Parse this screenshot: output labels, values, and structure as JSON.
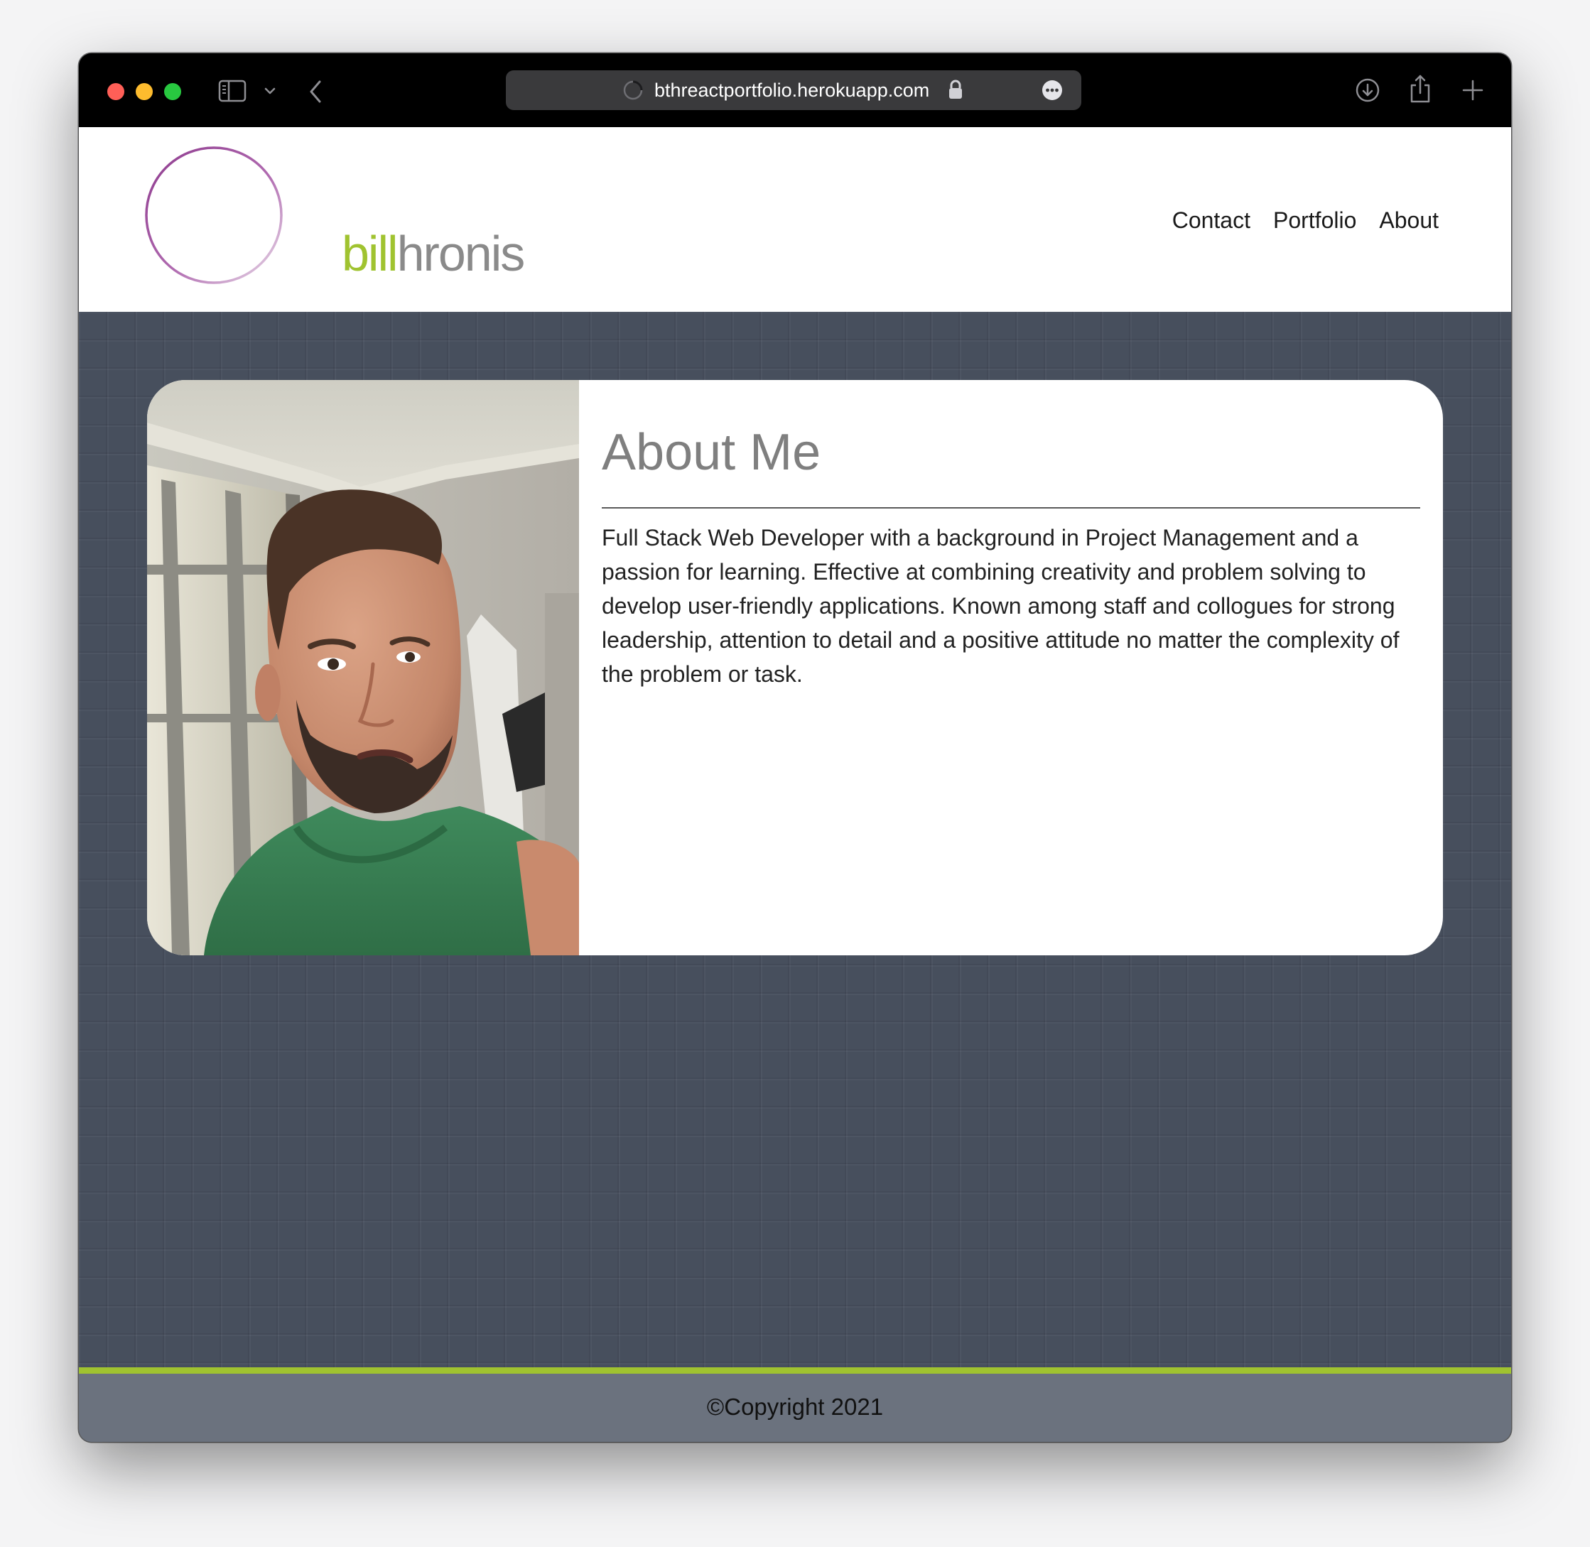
{
  "browser": {
    "url": "bthreactportfolio.herokuapp.com",
    "icons": [
      "sidebar-icon",
      "chevron-down-icon",
      "back-arrow-icon",
      "loading-spinner-icon",
      "lock-icon",
      "more-icon",
      "download-icon",
      "share-icon",
      "plus-icon"
    ]
  },
  "site": {
    "logo": {
      "first": "bill",
      "last": "hronis"
    },
    "nav": [
      "Contact",
      "Portfolio",
      "About"
    ]
  },
  "about": {
    "heading": "About Me",
    "body": "Full Stack Web Developer with a background in Project Management and a passion for learning. Effective at combining creativity and problem solving to develop user-friendly applications. Known among staff and collogues for strong leadership, attention to detail and a positive attitude no matter the complexity of the problem or task."
  },
  "footer": {
    "copyright": "©Copyright 2021"
  },
  "colors": {
    "accent_green": "#a0c330",
    "accent_purple": "#8e3b8e",
    "page_bg": "#474f5d",
    "footer_bg": "#6b727e"
  }
}
